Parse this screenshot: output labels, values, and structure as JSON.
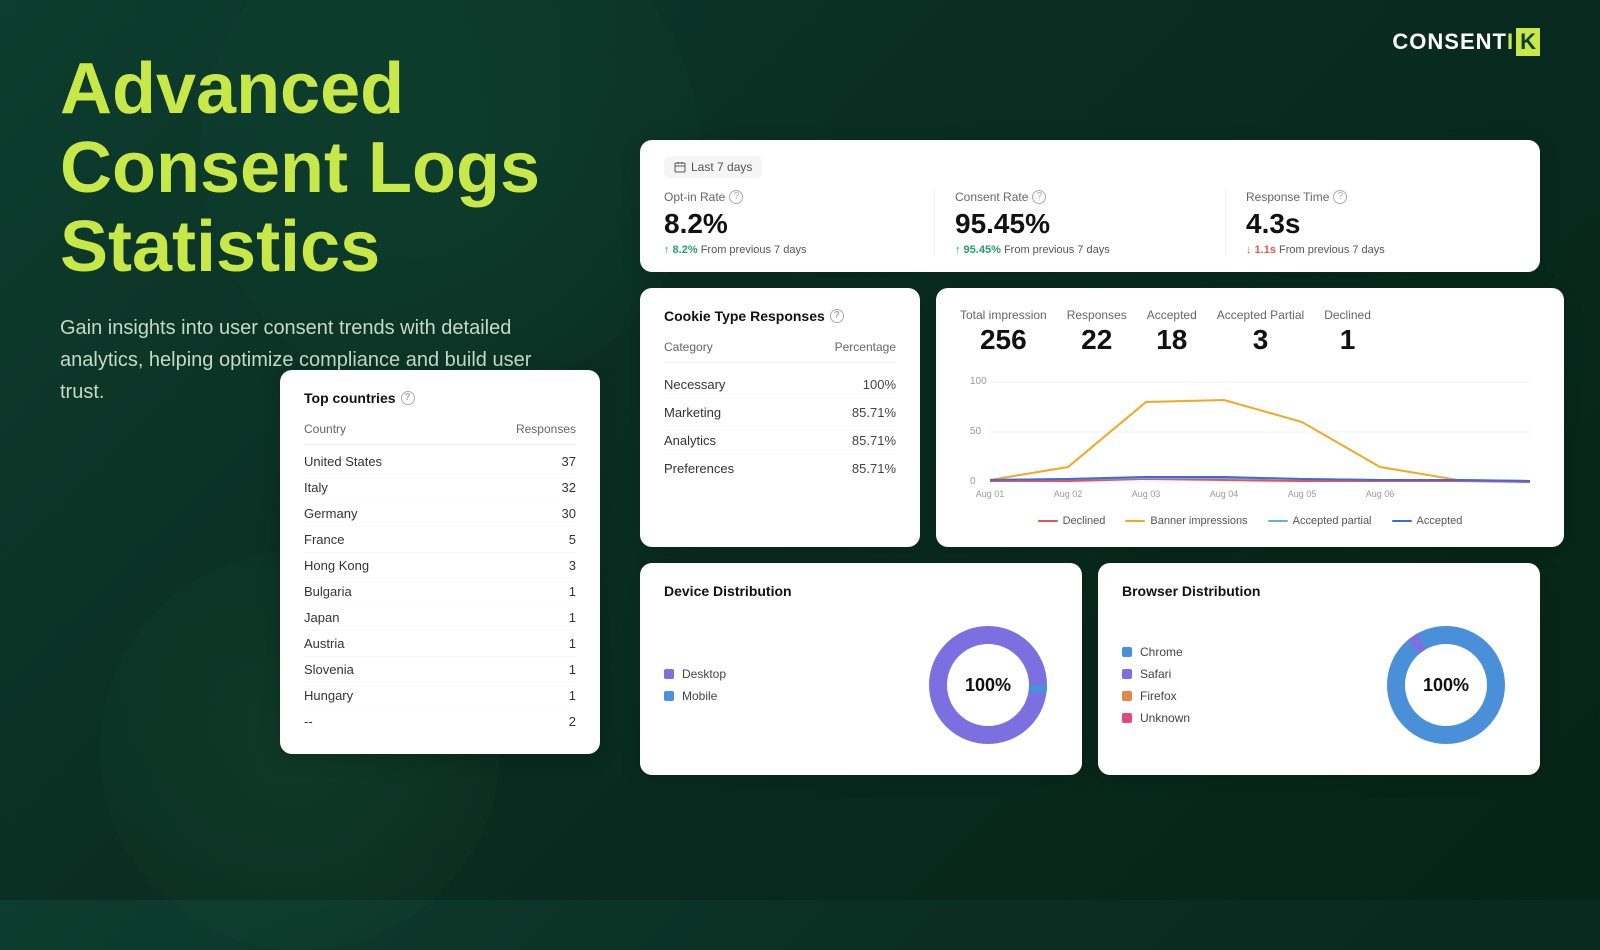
{
  "logo": {
    "text_before": "CONSENT",
    "text_i": "I",
    "text_k": "K"
  },
  "hero": {
    "title": "Advanced Consent Logs Statistics",
    "subtitle": "Gain insights into user consent trends with detailed analytics, helping optimize compliance and build user trust."
  },
  "stats_card": {
    "date_label": "Last 7 days",
    "metrics": [
      {
        "label": "Opt-in Rate",
        "value": "8.2%",
        "change_up": "↑ 8.2%",
        "change_text": " From previous 7 days",
        "direction": "up"
      },
      {
        "label": "Consent Rate",
        "value": "95.45%",
        "change_up": "↑ 95.45%",
        "change_text": " From previous 7 days",
        "direction": "up"
      },
      {
        "label": "Response Time",
        "value": "4.3s",
        "change_down": "↓ 1.1s",
        "change_text": " From previous 7 days",
        "direction": "down"
      }
    ]
  },
  "cookie_types": {
    "title": "Cookie Type Responses",
    "columns": [
      "Category",
      "Percentage"
    ],
    "rows": [
      {
        "category": "Necessary",
        "percentage": "100%"
      },
      {
        "category": "Marketing",
        "percentage": "85.71%"
      },
      {
        "category": "Analytics",
        "percentage": "85.71%"
      },
      {
        "category": "Preferences",
        "percentage": "85.71%"
      }
    ]
  },
  "chart": {
    "metrics": [
      {
        "label": "Total impression",
        "value": "256"
      },
      {
        "label": "Responses",
        "value": "22"
      },
      {
        "label": "Accepted",
        "value": "18"
      },
      {
        "label": "Accepted Partial",
        "value": "3"
      },
      {
        "label": "Declined",
        "value": "1"
      }
    ],
    "x_labels": [
      "Aug 01",
      "Aug 02",
      "Aug 03",
      "Aug 04",
      "Aug 05",
      "Aug 06"
    ],
    "y_labels": [
      "100",
      "50",
      "0"
    ],
    "legend": [
      {
        "color": "#e85454",
        "label": "Declined"
      },
      {
        "color": "#f5a623",
        "label": "Banner impressions"
      },
      {
        "color": "#6ab0de",
        "label": "Accepted partial"
      },
      {
        "color": "#3b6bde",
        "label": "Accepted"
      }
    ]
  },
  "countries": {
    "title": "Top countries",
    "columns": [
      "Country",
      "Responses"
    ],
    "rows": [
      {
        "country": "United States",
        "responses": "37"
      },
      {
        "country": "Italy",
        "responses": "32"
      },
      {
        "country": "Germany",
        "responses": "30"
      },
      {
        "country": "France",
        "responses": "5"
      },
      {
        "country": "Hong Kong",
        "responses": "3"
      },
      {
        "country": "Bulgaria",
        "responses": "1"
      },
      {
        "country": "Japan",
        "responses": "1"
      },
      {
        "country": "Austria",
        "responses": "1"
      },
      {
        "country": "Slovenia",
        "responses": "1"
      },
      {
        "country": "Hungary",
        "responses": "1"
      },
      {
        "country": "--",
        "responses": "2"
      }
    ]
  },
  "device_dist": {
    "title": "Device Distribution",
    "center_label": "100%",
    "legend": [
      {
        "color": "#7c6fe0",
        "label": "Desktop"
      },
      {
        "color": "#4a90d9",
        "label": "Mobile"
      }
    ]
  },
  "browser_dist": {
    "title": "Browser Distribution",
    "center_label": "100%",
    "legend": [
      {
        "color": "#4a90d9",
        "label": "Chrome"
      },
      {
        "color": "#7c6fe0",
        "label": "Safari"
      },
      {
        "color": "#e0874a",
        "label": "Firefox"
      },
      {
        "color": "#e04a7c",
        "label": "Unknown"
      }
    ]
  }
}
